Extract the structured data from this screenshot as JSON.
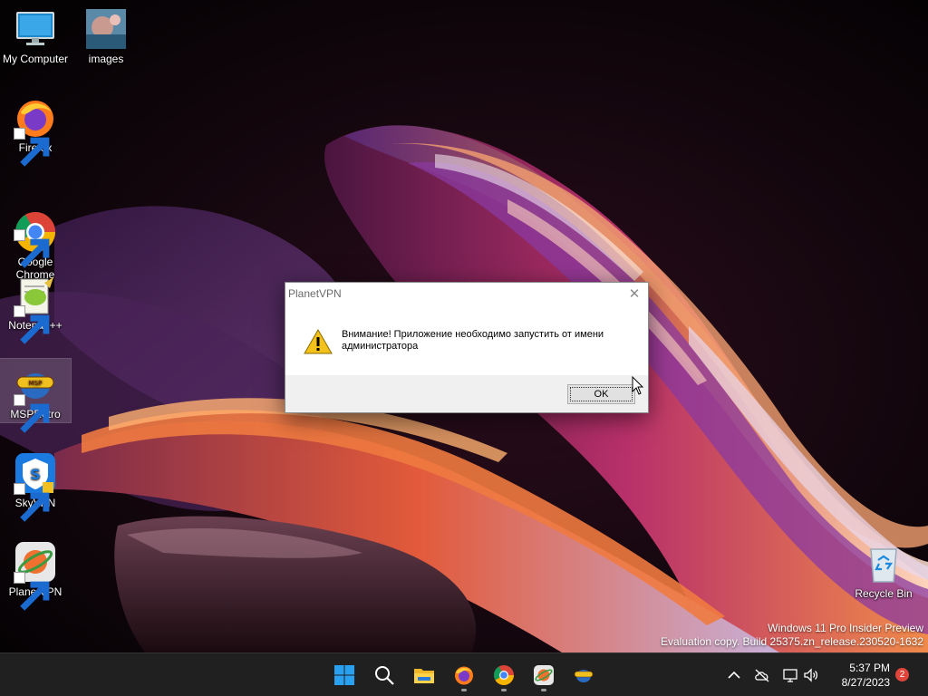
{
  "desktop": {
    "icons": [
      {
        "label": "My Computer"
      },
      {
        "label": "images"
      },
      {
        "label": "Firefox"
      },
      {
        "label": "Google\nChrome"
      },
      {
        "label": "Notepad++"
      },
      {
        "label": "MSPRetro"
      },
      {
        "label": "SkyVPN"
      },
      {
        "label": "PlanetVPN"
      },
      {
        "label": "Recycle Bin"
      }
    ],
    "watermark": {
      "line1": "Windows 11 Pro Insider Preview",
      "line2": "Evaluation copy. Build 25375.zn_release.230520-1632"
    }
  },
  "dialog": {
    "title": "PlanetVPN",
    "close_glyph": "✕",
    "message": "Внимание! Приложение необходимо запустить от имени администратора",
    "ok_label": "OK",
    "icon": "warning-icon"
  },
  "taskbar": {
    "apps": [
      "start-icon",
      "search-icon",
      "file-explorer-icon",
      "firefox-icon",
      "chrome-icon",
      "planetvpn-icon",
      "mspretro-icon"
    ],
    "tray": [
      "chevron-up-icon",
      "cloud-off-icon",
      "network-icon",
      "volume-icon"
    ],
    "time": "5:37 PM",
    "date": "8/27/2023",
    "notification_count": "2"
  },
  "colors": {
    "taskbar_bg": "#202020",
    "accent": "#0078d4",
    "warning": "#f2c21b"
  }
}
